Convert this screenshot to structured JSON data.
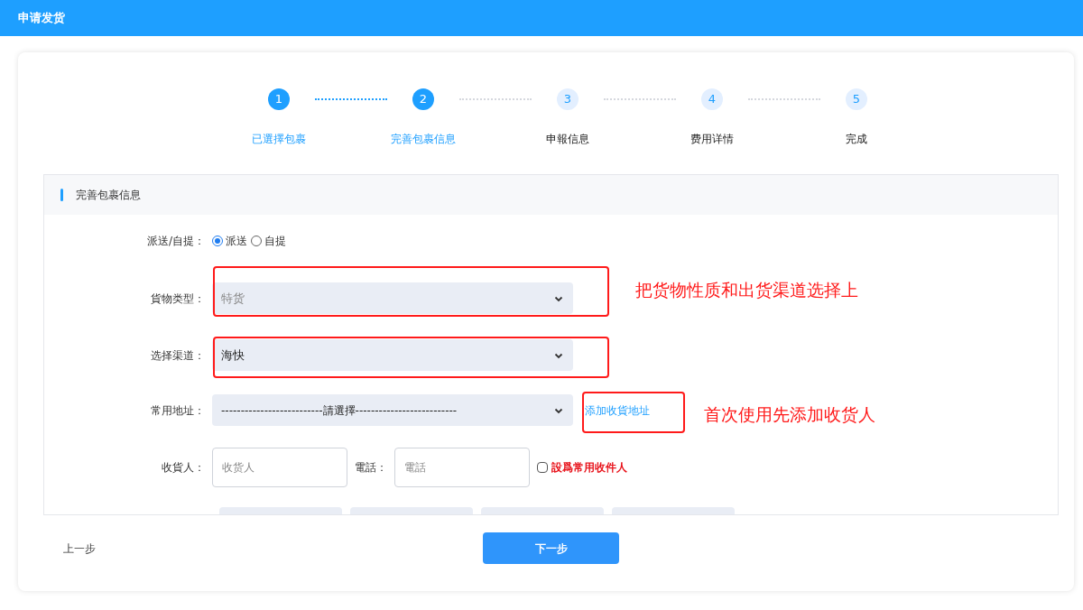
{
  "window": {
    "title": "申请发货"
  },
  "steps": [
    {
      "number": "1",
      "label": "已選擇包裹",
      "completed": true
    },
    {
      "number": "2",
      "label": "完善包裹信息",
      "completed": true
    },
    {
      "number": "3",
      "label": "申報信息",
      "completed": false
    },
    {
      "number": "4",
      "label": "费用详情",
      "completed": false
    },
    {
      "number": "5",
      "label": "完成",
      "completed": false
    }
  ],
  "section": {
    "title": "完善包裹信息"
  },
  "form": {
    "delivery": {
      "label": "派送/自提：",
      "options": [
        {
          "label": "派送",
          "selected": true
        },
        {
          "label": "自提",
          "selected": false
        }
      ]
    },
    "cargo_type": {
      "label": "貨物类型：",
      "value": "特货",
      "disabled": true
    },
    "channel": {
      "label": "选择渠道：",
      "value": "海快",
      "disabled": false
    },
    "address": {
      "label": "常用地址：",
      "value": "--------------------------請選擇--------------------------",
      "link": "添加收貨地址"
    },
    "recipient": {
      "label": "收貨人：",
      "placeholder": "收货人"
    },
    "phone": {
      "label": "電話：",
      "placeholder": "電話"
    },
    "save_contact": {
      "label": "設爲常用收件人",
      "checked": false
    }
  },
  "annotations": [
    {
      "text": "把货物性质和出货渠道选择上"
    },
    {
      "text": "首次使用先添加收货人"
    }
  ],
  "buttons": {
    "prev": "上一步",
    "next": "下一步"
  }
}
